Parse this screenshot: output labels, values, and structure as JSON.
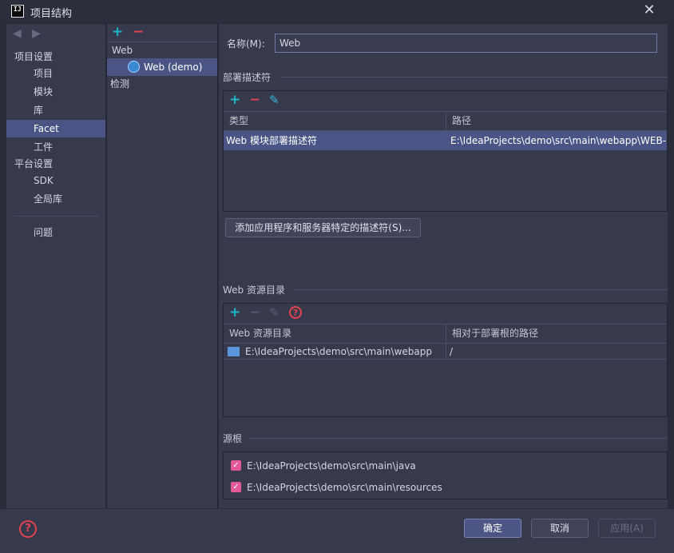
{
  "window": {
    "title": "项目结构",
    "logo_text": "IJ"
  },
  "nav": {
    "project_settings_label": "项目设置",
    "items": [
      "项目",
      "模块",
      "库",
      "Facet",
      "工件"
    ],
    "platform_settings_label": "平台设置",
    "platform_items": [
      "SDK",
      "全局库"
    ],
    "problems_label": "问题",
    "selected": "Facet"
  },
  "facets": {
    "group_label": "Web",
    "item_label": "Web (demo)",
    "detection_label": "检测"
  },
  "name_field": {
    "label": "名称(M):",
    "value": "Web"
  },
  "deployment": {
    "section_title": "部署描述符",
    "columns": [
      "类型",
      "路径"
    ],
    "rows": [
      {
        "type": "Web 模块部署描述符",
        "path": "E:\\IdeaProjects\\demo\\src\\main\\webapp\\WEB-"
      }
    ],
    "add_button": "添加应用程序和服务器特定的描述符(S)..."
  },
  "resources": {
    "section_title": "Web 资源目录",
    "columns": [
      "Web 资源目录",
      "相对于部署根的路径"
    ],
    "rows": [
      {
        "dir": "E:\\IdeaProjects\\demo\\src\\main\\webapp",
        "relative": "/"
      }
    ]
  },
  "source_roots": {
    "section_title": "源根",
    "items": [
      {
        "path": "E:\\IdeaProjects\\demo\\src\\main\\java",
        "checked": true
      },
      {
        "path": "E:\\IdeaProjects\\demo\\src\\main\\resources",
        "checked": true
      }
    ]
  },
  "footer": {
    "ok": "确定",
    "cancel": "取消",
    "apply": "应用(A)"
  },
  "colors": {
    "accent": "#1bb5c6",
    "remove": "#e3434e",
    "selection": "#4a5586",
    "checkbox": "#e35a97"
  }
}
